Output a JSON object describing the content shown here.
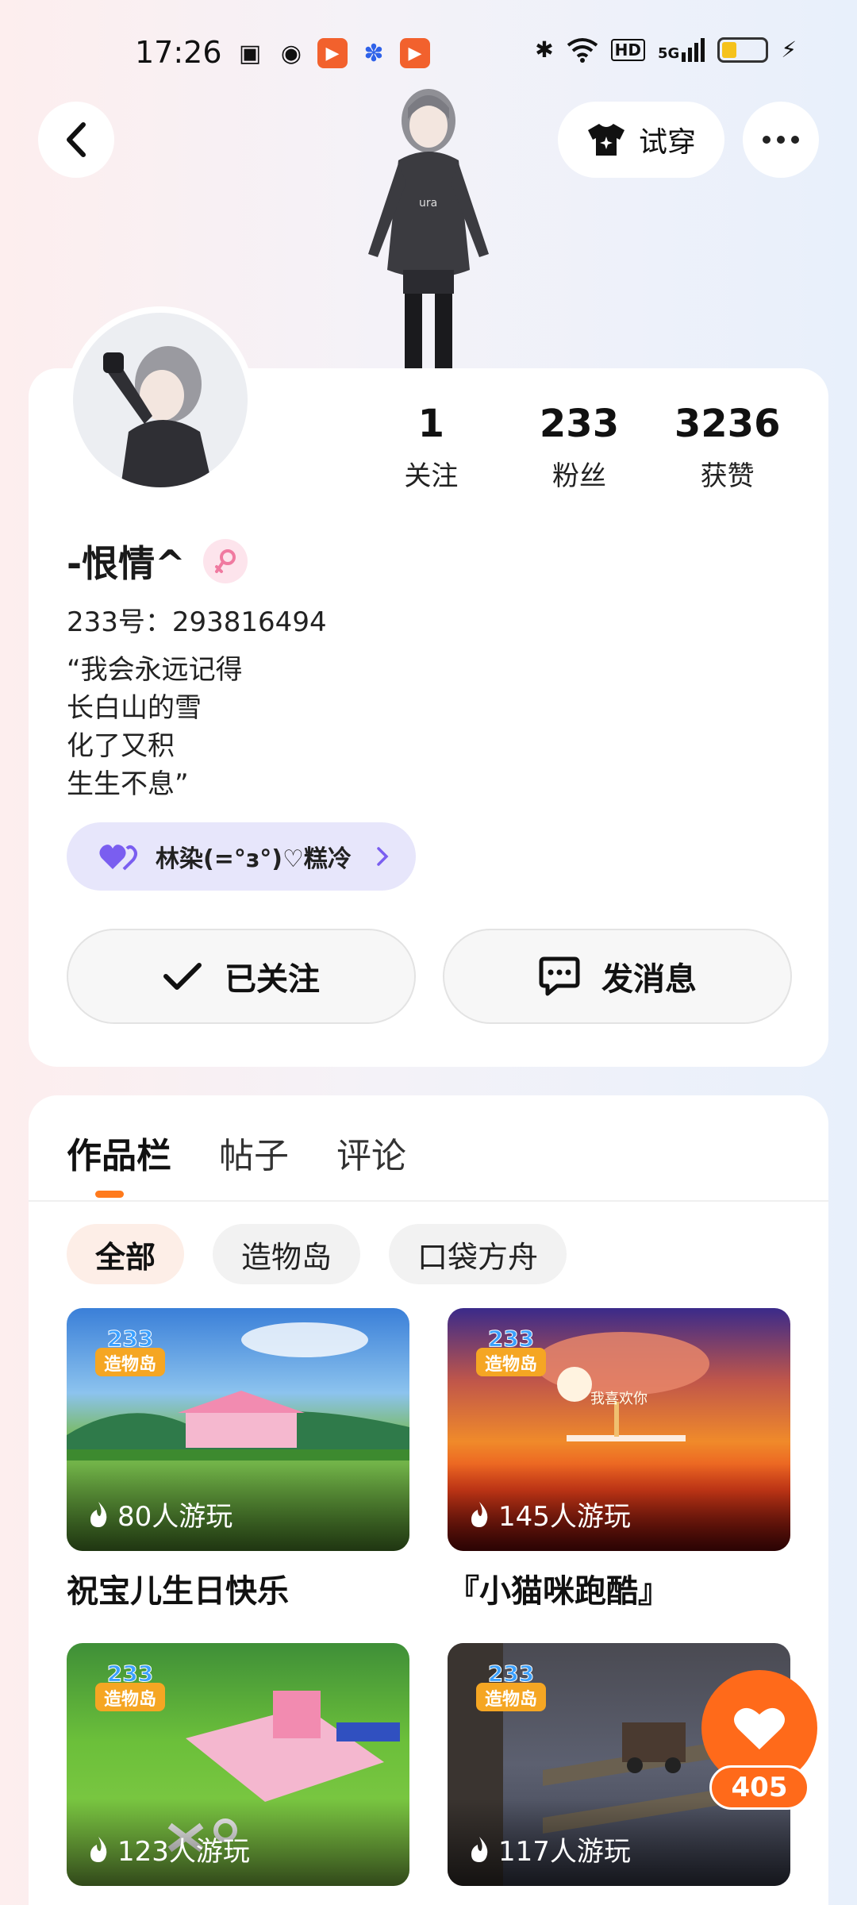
{
  "status_bar": {
    "time": "17:26",
    "network": "5G",
    "hd": "HD"
  },
  "header": {
    "tryon_label": "试穿"
  },
  "profile": {
    "stats": [
      {
        "value": "1",
        "label": "关注"
      },
      {
        "value": "233",
        "label": "粉丝"
      },
      {
        "value": "3236",
        "label": "获赞"
      }
    ],
    "nickname": "-恨情^",
    "gender": "female",
    "account_id": "233号：293816494",
    "bio": "“我会永远记得\n长白山的雪\n化了又积\n生生不息”",
    "partner_name": "林染(=°з°)♡糕冷",
    "followed_label": "已关注",
    "message_label": "发消息"
  },
  "works": {
    "tabs": [
      "作品栏",
      "帖子",
      "评论"
    ],
    "active_tab": 0,
    "filters": [
      "全部",
      "造物岛",
      "口袋方舟"
    ],
    "active_filter": 0,
    "games": [
      {
        "title": "祝宝儿生日快乐",
        "players": "80人游玩",
        "theme": "pink-house"
      },
      {
        "title": "『小猫咪跑酷』",
        "players": "145人游玩",
        "theme": "sunset"
      },
      {
        "title": "",
        "players": "123人游玩",
        "theme": "pink-castle"
      },
      {
        "title": "",
        "players": "117人游玩",
        "theme": "mine-cart"
      }
    ],
    "thumb_overlay_text": "我喜欢你"
  },
  "like_fab": {
    "count": "405"
  },
  "colors": {
    "accent": "#ff7a1c",
    "like": "#ff6a1a",
    "partner_pill": "#e7e6fb"
  }
}
